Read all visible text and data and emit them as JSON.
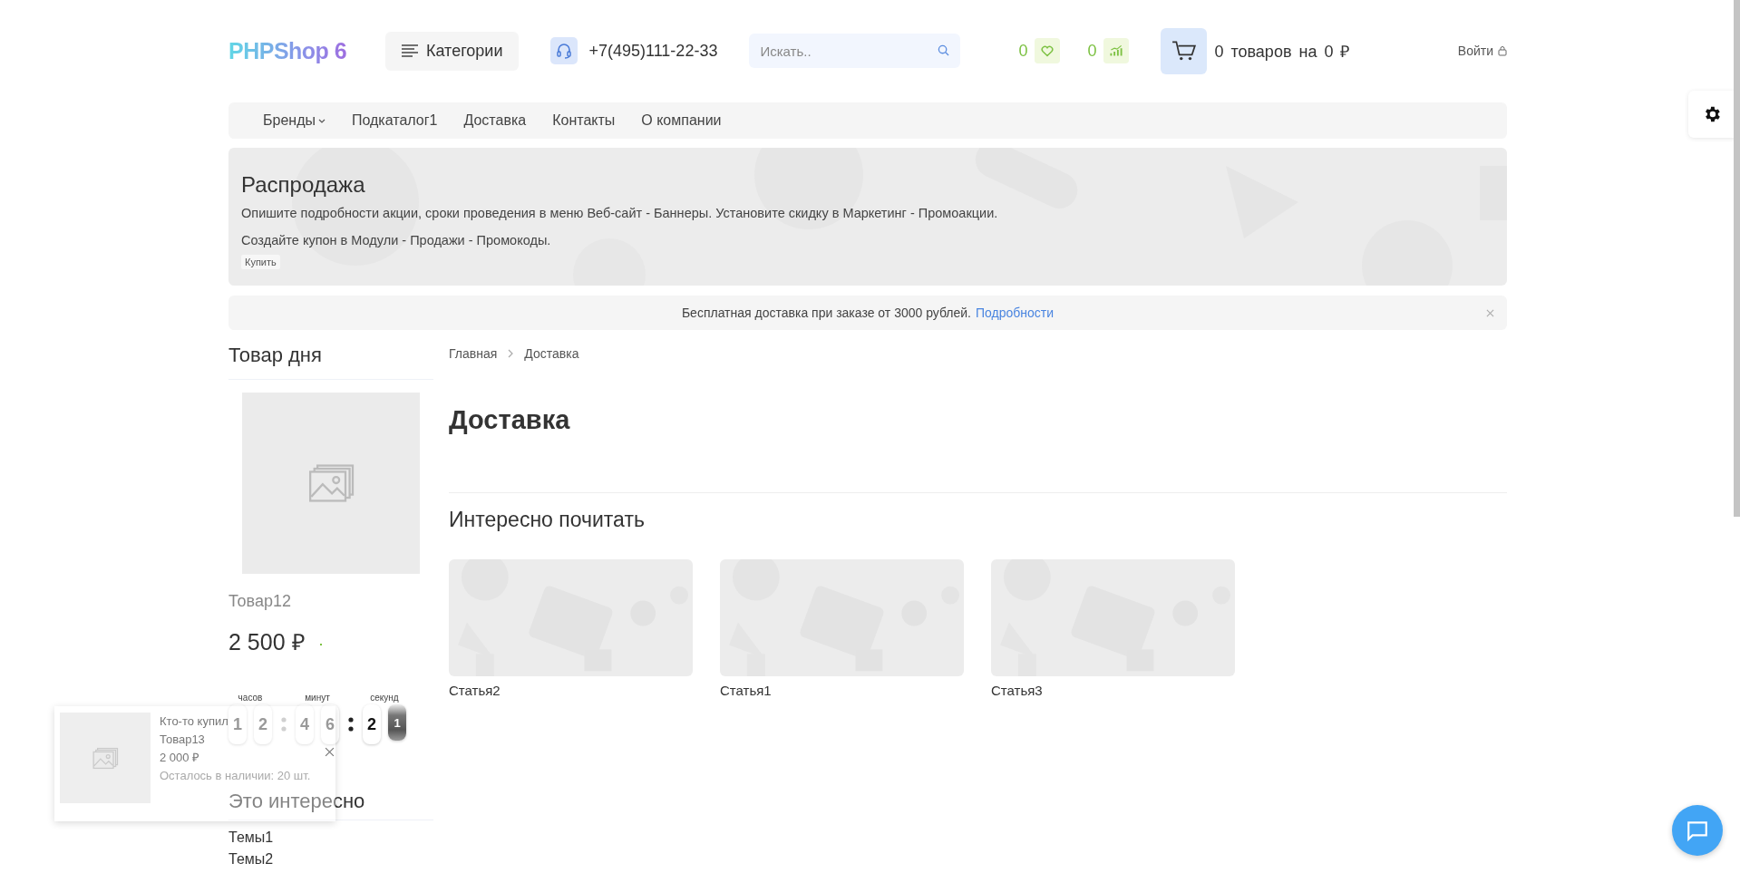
{
  "header": {
    "logo": "PHPShop 6",
    "catalog_button": "Категории",
    "phone": "+7(495)111-22-33",
    "search": {
      "placeholder": "Искать.."
    },
    "wishlist_count": "0",
    "compare_count": "0",
    "cart_text": "0 товаров на 0 ₽",
    "login": "Войти"
  },
  "nav": [
    {
      "label": "Бренды",
      "dropdown": true
    },
    {
      "label": "Подкаталог1",
      "dropdown": false
    },
    {
      "label": "Доставка",
      "dropdown": false
    },
    {
      "label": "Контакты",
      "dropdown": false
    },
    {
      "label": "О компании",
      "dropdown": false
    }
  ],
  "banner": {
    "title": "Распродажа",
    "lines": [
      "Опишите подробности акции, сроки проведения в меню Веб-сайт - Баннеры. Установите скидку в Маркетинг - Промоакции.",
      "Создайте купон в Модули - Продажи - Промокоды."
    ],
    "button": "Купить"
  },
  "notice": {
    "text": "Бесплатная доставка при заказе от 3000 рублей.",
    "link": "Подробности"
  },
  "product_of_day": {
    "heading": "Товар дня",
    "name": "Товар12",
    "price": "2 500 ₽",
    "countdown": [
      {
        "label": "часов",
        "digits": [
          {
            "value": "1",
            "flipping": false
          },
          {
            "value": "2",
            "flipping": false
          }
        ]
      },
      {
        "label": "минут",
        "digits": [
          {
            "value": "4",
            "flipping": false
          },
          {
            "value": "6",
            "flipping": false
          }
        ]
      },
      {
        "label": "секунд",
        "digits": [
          {
            "value": "2",
            "flipping": false
          },
          {
            "value": "1",
            "flipping": true
          }
        ]
      }
    ]
  },
  "interesting": {
    "heading": "Это интересно",
    "items": [
      "Темы1",
      "Темы2"
    ]
  },
  "breadcrumb": [
    "Главная",
    "Доставка"
  ],
  "page_title": "Доставка",
  "articles": {
    "heading": "Интересно почитать",
    "items": [
      "Статья2",
      "Статья1",
      "Статья3"
    ]
  },
  "purchase_popup": {
    "caption": "Кто-то купил",
    "product": "Товар13",
    "price": "2 000  ₽",
    "stock": "Осталось в наличии: 20 шт."
  }
}
